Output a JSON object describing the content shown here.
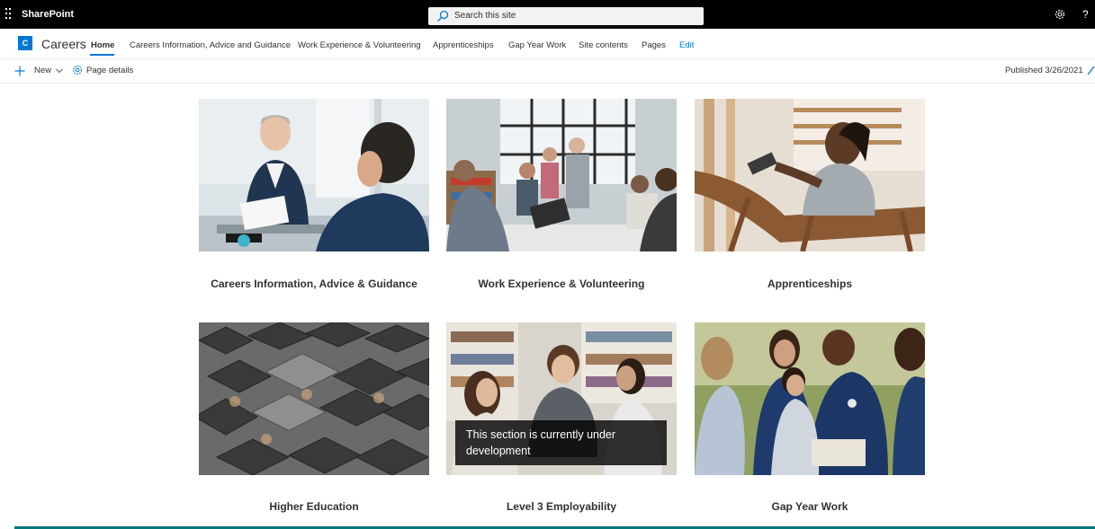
{
  "suite_bar": {
    "app_name": "SharePoint",
    "search_placeholder": "Search this site",
    "help_label": "?"
  },
  "site": {
    "logo_letter": "C",
    "title": "Careers",
    "nav": [
      {
        "label": "Home",
        "active": true
      },
      {
        "label": "Careers Information, Advice and Guidance"
      },
      {
        "label": "Work Experience & Volunteering"
      },
      {
        "label": "Apprenticeships"
      },
      {
        "label": "Gap Year Work"
      },
      {
        "label": "Site contents"
      },
      {
        "label": "Pages"
      },
      {
        "label": "Edit"
      }
    ]
  },
  "command_bar": {
    "new_label": "New",
    "page_details_label": "Page details",
    "published_label": "Published 3/26/2021"
  },
  "tiles": [
    {
      "title": "Careers Information, Advice & Guidance",
      "image": "business-meeting-photo"
    },
    {
      "title": "Work Experience & Volunteering",
      "image": "office-team-photo"
    },
    {
      "title": "Apprenticeships",
      "image": "woodworking-apprentice-photo"
    },
    {
      "title": "Higher Education",
      "image": "graduation-caps-photo"
    },
    {
      "title": "Level 3 Employability",
      "image": "students-library-photo",
      "overlay": "This section is currently under development"
    },
    {
      "title": "Gap Year Work",
      "image": "volunteers-with-child-photo"
    }
  ],
  "colors": {
    "suite_bar": "#000000",
    "accent": "#0078d4",
    "footer_bar": "#03787c"
  }
}
